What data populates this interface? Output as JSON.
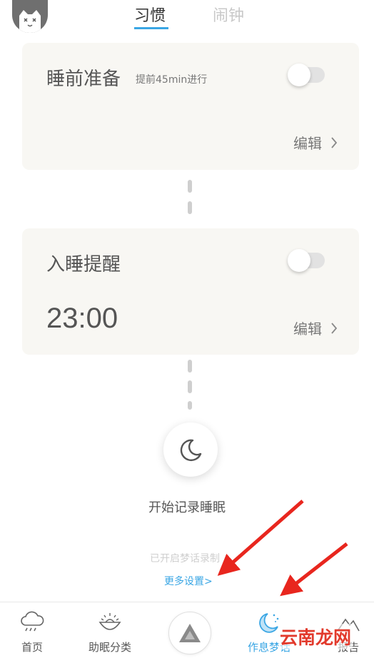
{
  "header": {
    "tabs": [
      {
        "label": "习惯",
        "active": true
      },
      {
        "label": "闹钟",
        "active": false
      }
    ]
  },
  "cards": {
    "prep": {
      "title": "睡前准备",
      "subtitle": "提前45min进行",
      "toggle_on": false,
      "edit_label": "编辑"
    },
    "reminder": {
      "title": "入睡提醒",
      "time": "23:00",
      "toggle_on": false,
      "edit_label": "编辑"
    }
  },
  "sleep": {
    "start_label": "开始记录睡眠",
    "dream_status": "已开启梦话录制",
    "more_settings": "更多设置>"
  },
  "navbar": {
    "items": [
      {
        "label": "首页",
        "icon": "cloud-rain-icon"
      },
      {
        "label": "助眠分类",
        "icon": "bowl-icon"
      },
      {
        "label": "",
        "icon": "triangle-icon"
      },
      {
        "label": "作息梦话",
        "icon": "moon-icon",
        "active": true
      },
      {
        "label": "报告",
        "icon": "mountain-icon"
      }
    ]
  },
  "watermark": "云南龙网",
  "colors": {
    "accent": "#3aa6e4",
    "card_bg": "#f8f7f3",
    "annotation_arrow": "#e8261e"
  }
}
